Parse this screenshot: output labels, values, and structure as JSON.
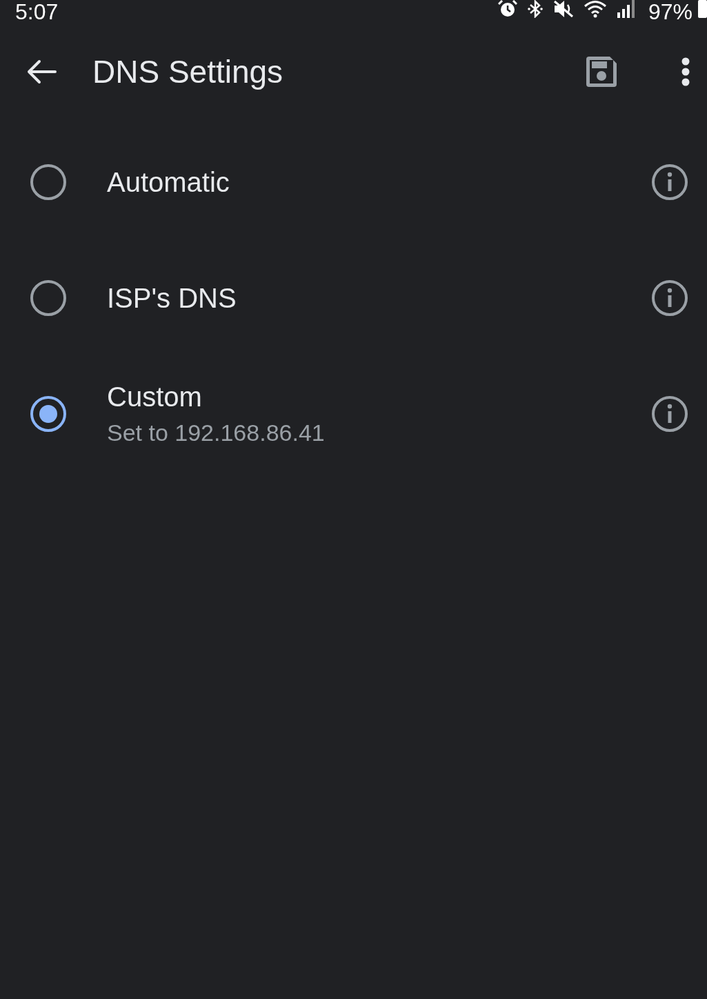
{
  "status_bar": {
    "time": "5:07",
    "battery": "97%"
  },
  "app_bar": {
    "title": "DNS Settings"
  },
  "options": [
    {
      "label": "Automatic",
      "selected": false
    },
    {
      "label": "ISP's DNS",
      "selected": false
    },
    {
      "label": "Custom",
      "subtitle": "Set to 192.168.86.41",
      "selected": true
    }
  ]
}
